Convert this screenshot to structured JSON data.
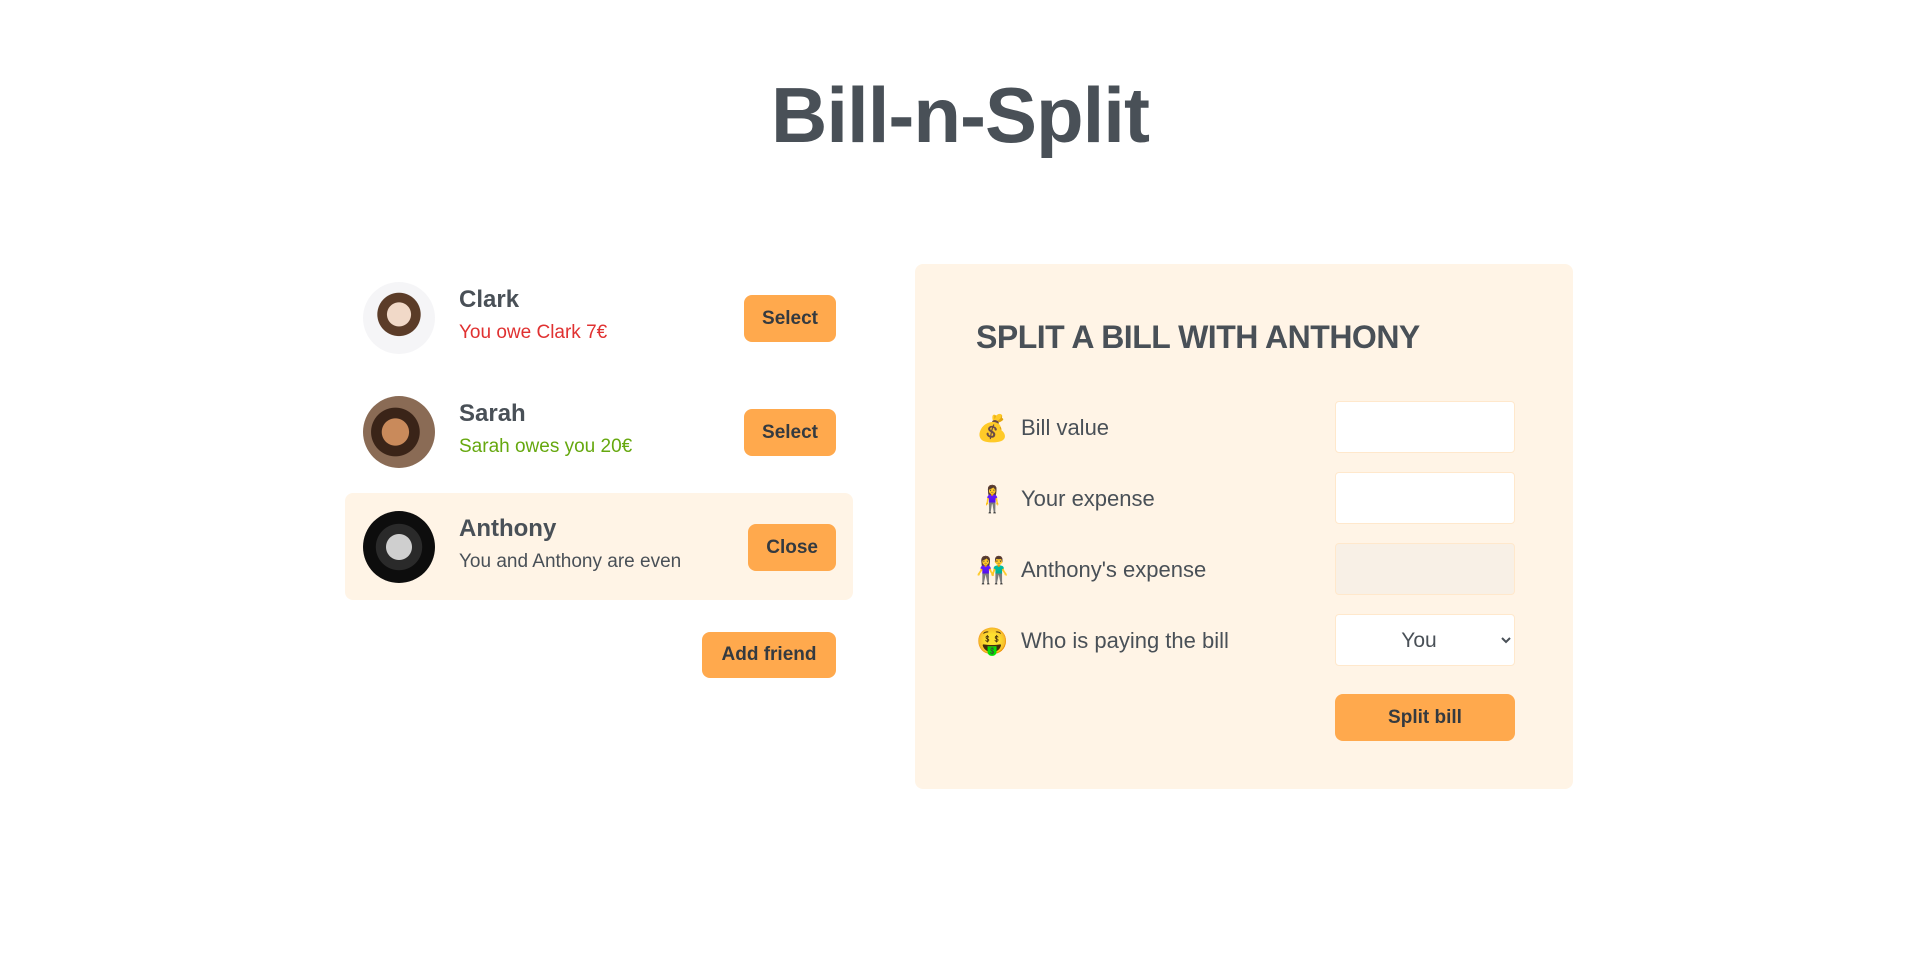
{
  "app": {
    "title": "Bill-n-Split"
  },
  "friends": [
    {
      "name": "Clark",
      "status": "You owe Clark 7€",
      "button": "Select",
      "status_color": "#e03131"
    },
    {
      "name": "Sarah",
      "status": "Sarah owes you 20€",
      "button": "Select",
      "status_color": "#66a80f"
    },
    {
      "name": "Anthony",
      "status": "You and Anthony are even",
      "button": "Close",
      "selected": true
    }
  ],
  "add_friend_label": "Add friend",
  "form": {
    "heading": "Split a bill with Anthony",
    "bill_value": {
      "emoji": "💰",
      "label": "Bill value",
      "value": ""
    },
    "your_expense": {
      "emoji": "🧍‍♀️",
      "label": "Your expense",
      "value": ""
    },
    "friend_expense": {
      "emoji": "👫",
      "label": "Anthony's expense",
      "value": ""
    },
    "payer": {
      "emoji": "🤑",
      "label": "Who is paying the bill",
      "selected": "You"
    },
    "submit_label": "Split bill"
  },
  "colors": {
    "accent": "#ffa94d",
    "panel_bg": "#fff4e6",
    "text": "#495057"
  }
}
